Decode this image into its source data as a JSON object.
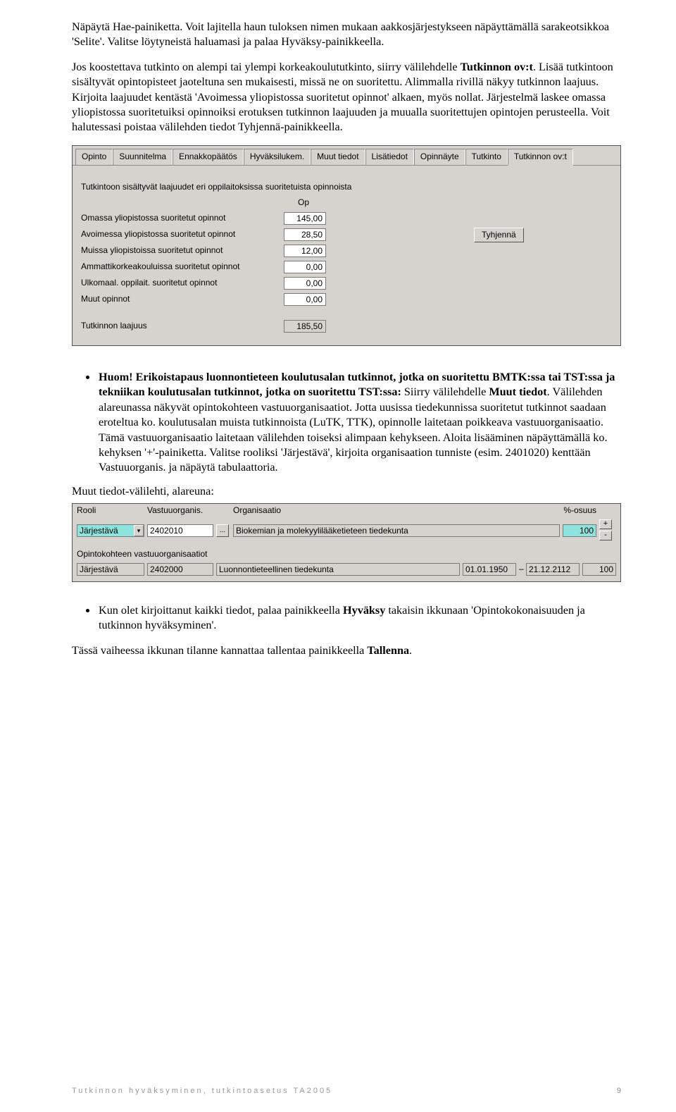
{
  "paragraph1": "Näpäytä Hae-painiketta. Voit lajitella haun tuloksen nimen mukaan aakkosjärjestykseen näpäyttämällä sarakeotsikkoa 'Selite'. Valitse löytyneistä haluamasi ja palaa Hyväksy-painikkeella.",
  "p2_a": "Jos koostettava tutkinto on alempi tai ylempi korkeakoulututkinto, siirry välilehdelle ",
  "p2_b": "Tutkinnon ov:t",
  "p2_c": ". Lisää tutkintoon sisältyvät opintopisteet jaoteltuna sen mukaisesti, missä ne on suoritettu. Alimmalla rivillä näkyy tutkinnon laajuus. Kirjoita laajuudet kentästä 'Avoimessa yliopistossa suoritetut opinnot' alkaen, myös nollat. Järjestelmä laskee omassa yliopistossa suoritetuiksi opinnoiksi erotuksen tutkinnon laajuuden ja muualla suoritettujen opintojen perusteella. Voit halutessasi poistaa välilehden tiedot Tyhjennä-painikkeella.",
  "win1": {
    "tabs": [
      "Opinto",
      "Suunnitelma",
      "Ennakkopäätös",
      "Hyväksilukem.",
      "Muut tiedot",
      "Lisätiedot",
      "Opinnäyte",
      "Tutkinto",
      "Tutkinnon ov:t"
    ],
    "section_title": "Tutkintoon sisältyvät laajuudet eri oppilaitoksissa suoritetuista opinnoista",
    "op_col": "Op",
    "rows": [
      {
        "label": "Omassa yliopistossa suoritetut opinnot",
        "value": "145,00"
      },
      {
        "label": "Avoimessa yliopistossa suoritetut opinnot",
        "value": "28,50"
      },
      {
        "label": "Muissa yliopistoissa suoritetut opinnot",
        "value": "12,00"
      },
      {
        "label": "Ammattikorkeakouluissa suoritetut opinnot",
        "value": "0,00"
      },
      {
        "label": "Ulkomaal. oppilait. suoritetut opinnot",
        "value": "0,00"
      },
      {
        "label": "Muut opinnot",
        "value": "0,00"
      }
    ],
    "tyhjenna": "Tyhjennä",
    "total_label": "Tutkinnon laajuus",
    "total_value": "185,50"
  },
  "note1_a": "Huom!",
  "note1_b": " Erikoistapaus luonnontieteen koulutusalan tutkinnot, jotka on suoritettu BMTK:ssa tai TST:ssa ja tekniikan koulutusalan tutkinnot, jotka on suoritettu TST:ssa:",
  "note1_c": " Siirry välilehdelle ",
  "note1_d": "Muut tiedot",
  "note1_e": ". Välilehden alareunassa näkyvät opintokohteen vastuuorganisaatiot. Jotta uusissa tiedekunnissa suoritetut tutkinnot saadaan eroteltua ko. koulutusalan muista tutkinnoista (LuTK, TTK), opinnolle laitetaan poikkeava vastuuorganisaatio. Tämä vastuuorganisaatio laitetaan välilehden toiseksi alimpaan kehykseen. Aloita lisääminen näpäyttämällä ko. kehyksen '+'-painiketta. Valitse rooliksi 'Järjestävä', kirjoita organisaation tunniste (esim. 2401020) kenttään Vastuuorganis. ja näpäytä tabulaattoria.",
  "subhead": "Muut tiedot-välilehti, alareuna:",
  "win2": {
    "cols": {
      "rooli": "Rooli",
      "vastuu": "Vastuuorganis.",
      "org": "Organisaatio",
      "pc": "%-osuus"
    },
    "row1": {
      "rooli": "Järjestävä",
      "vastuu": "2402010",
      "org": "Biokemian ja molekyylilääketieteen tiedekunta",
      "pc": "100"
    },
    "section_title": "Opintokohteen vastuuorganisaatiot",
    "row2": {
      "rooli": "Järjestävä",
      "vastuu": "2402000",
      "org": "Luonnontieteellinen tiedekunta",
      "d1": "01.01.1950",
      "d2": "21.12.2112",
      "pc": "100"
    },
    "plus": "+",
    "minus": "-",
    "dots": "..."
  },
  "note2_a": "Kun olet kirjoittanut kaikki tiedot, palaa painikkeella ",
  "note2_b": "Hyväksy",
  "note2_c": " takaisin ikkunaan 'Opintokokonaisuuden ja tutkinnon hyväksyminen'.",
  "last_a": "Tässä vaiheessa ikkunan tilanne kannattaa tallentaa painikkeella ",
  "last_b": "Tallenna",
  "last_c": ".",
  "footer_left": "Tutkinnon hyväksyminen, tutkintoasetus TA2005",
  "footer_right": "9"
}
